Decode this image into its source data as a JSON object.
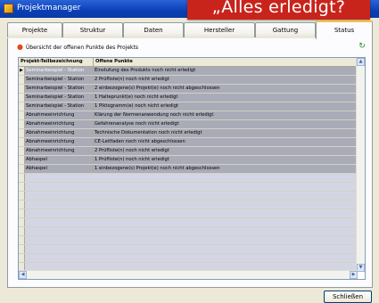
{
  "window": {
    "title": "Projektmanager",
    "banner": "„Alles erledigt?"
  },
  "tabs": [
    {
      "label": "Projekte"
    },
    {
      "label": "Struktur"
    },
    {
      "label": "Daten"
    },
    {
      "label": "Hersteller"
    },
    {
      "label": "Gattung"
    },
    {
      "label": "Status",
      "active": true
    }
  ],
  "panel": {
    "heading": "Übersicht der offenen Punkte des Projekts",
    "icons": {
      "heading_bullet": "bullet-icon",
      "refresh": "refresh-icon"
    }
  },
  "grid": {
    "columns": [
      "Projekt-Teilbezeichnung",
      "Offene Punkte"
    ],
    "rows": [
      {
        "part": "Seminarbeispiel - Station",
        "issue": "Einstufung des Produkts noch nicht erledigt"
      },
      {
        "part": "Seminarbeispiel - Station",
        "issue": "2 Prüfliste(n) noch nicht erledigt"
      },
      {
        "part": "Seminarbeispiel - Station",
        "issue": "2 einbezogene(s) Projekt(e) noch nicht abgeschlossen"
      },
      {
        "part": "Seminarbeispiel - Station",
        "issue": "1 Halteprunkt(e) noch nicht erledigt"
      },
      {
        "part": "Seminarbeispiel - Station",
        "issue": "1 Piktogramm(e) noch nicht erledigt"
      },
      {
        "part": "Abnahmeeinrichtung",
        "issue": "Klärung der Normenanwendung noch nicht erledigt"
      },
      {
        "part": "Abnahmeeinrichtung",
        "issue": "Gefahrenanalyse noch nicht erledigt"
      },
      {
        "part": "Abnahmeeinrichtung",
        "issue": "Technische Dokumentation noch nicht erledigt"
      },
      {
        "part": "Abnahmeeinrichtung",
        "issue": "CE-Leitfaden noch nicht abgeschlossen"
      },
      {
        "part": "Abnahmeeinrichtung",
        "issue": "2 Prüfliste(n) noch nicht erledigt"
      },
      {
        "part": "Abhaspel",
        "issue": "1 Prüfliste(n) noch nicht erledigt"
      },
      {
        "part": "Abhaspel",
        "issue": "1 einbezogene(s) Projekt(e) noch nicht abgeschlossen"
      }
    ]
  },
  "footer": {
    "close_label": "Schließen"
  },
  "colors": {
    "titlebar": "#0a3fb6",
    "banner": "#c8241c",
    "selected_cell": "#8f8f95",
    "row_fill": "#a9abb7"
  }
}
